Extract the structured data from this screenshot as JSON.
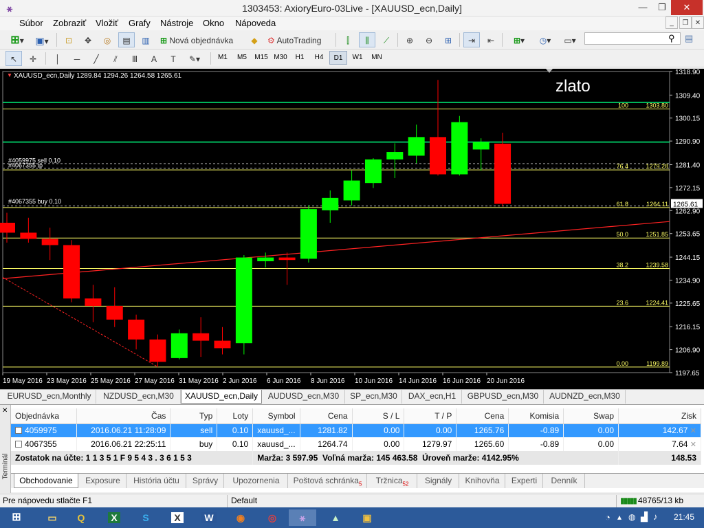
{
  "window": {
    "title": "1303453: AxioryEuro-03Live - [XAUUSD_ecn,Daily]",
    "minimize": "—",
    "restore": "❐",
    "close": "✕"
  },
  "menu": [
    "Súbor",
    "Zobraziť",
    "Vložiť",
    "Grafy",
    "Nástroje",
    "Okno",
    "Nápoveda"
  ],
  "toolbar": {
    "new_order": "Nová objednávka",
    "autotrading": "AutoTrading",
    "timeframes": [
      "M1",
      "M5",
      "M15",
      "M30",
      "H1",
      "H4",
      "D1",
      "W1",
      "MN"
    ],
    "active_timeframe": "D1"
  },
  "chart": {
    "header": "XAUUSD_ecn,Daily  1289.84 1294.26 1264.58 1265.61",
    "symbol_text": "zlato",
    "current_price_label": "1265.61",
    "order_labels": [
      "#4059975 sell 0.10",
      "#4067355 tp",
      "#4067355 buy 0.10"
    ],
    "colors": {
      "bull": "#00ff00",
      "bear": "#ff0000",
      "fib": "#ffff66",
      "order": "#00ff80",
      "trend": "#ff2222",
      "axis": "#ffffff"
    }
  },
  "chart_data": {
    "type": "candlestick",
    "title": "XAUUSD_ecn,Daily",
    "ylim": [
      1197.65,
      1318.9
    ],
    "y_ticks": [
      "1318.90",
      "1309.40",
      "1300.15",
      "1290.90",
      "1281.40",
      "1272.15",
      "1262.90",
      "1253.65",
      "1244.15",
      "1234.90",
      "1225.65",
      "1216.15",
      "1206.90",
      "1197.65"
    ],
    "x_ticks": [
      "19 May 2016",
      "23 May 2016",
      "25 May 2016",
      "27 May 2016",
      "31 May 2016",
      "2 Jun 2016",
      "6 Jun 2016",
      "8 Jun 2016",
      "10 Jun 2016",
      "14 Jun 2016",
      "16 Jun 2016",
      "20 Jun 2016"
    ],
    "candles": [
      {
        "o": 1258.0,
        "h": 1262.0,
        "l": 1250.0,
        "c": 1254.0
      },
      {
        "o": 1254.0,
        "h": 1260.0,
        "l": 1250.0,
        "c": 1251.5
      },
      {
        "o": 1251.5,
        "h": 1256.0,
        "l": 1243.0,
        "c": 1249.0
      },
      {
        "o": 1249.0,
        "h": 1251.0,
        "l": 1226.0,
        "c": 1227.5
      },
      {
        "o": 1227.5,
        "h": 1233.0,
        "l": 1218.0,
        "c": 1224.5
      },
      {
        "o": 1224.5,
        "h": 1232.0,
        "l": 1216.0,
        "c": 1219.0
      },
      {
        "o": 1219.0,
        "h": 1221.0,
        "l": 1207.0,
        "c": 1211.0
      },
      {
        "o": 1211.0,
        "h": 1213.0,
        "l": 1199.9,
        "c": 1202.0
      },
      {
        "o": 1203.5,
        "h": 1215.0,
        "l": 1203.0,
        "c": 1213.5
      },
      {
        "o": 1213.5,
        "h": 1220.0,
        "l": 1204.0,
        "c": 1210.5
      },
      {
        "o": 1210.5,
        "h": 1216.0,
        "l": 1205.0,
        "c": 1207.5
      },
      {
        "o": 1209.5,
        "h": 1245.0,
        "l": 1205.0,
        "c": 1244.0
      },
      {
        "o": 1242.5,
        "h": 1246.0,
        "l": 1240.0,
        "c": 1244.0
      },
      {
        "o": 1244.0,
        "h": 1246.0,
        "l": 1233.0,
        "c": 1243.0
      },
      {
        "o": 1243.5,
        "h": 1265.0,
        "l": 1242.0,
        "c": 1263.5
      },
      {
        "o": 1263.0,
        "h": 1271.0,
        "l": 1258.0,
        "c": 1268.0
      },
      {
        "o": 1267.0,
        "h": 1279.0,
        "l": 1265.0,
        "c": 1275.0
      },
      {
        "o": 1274.0,
        "h": 1284.0,
        "l": 1272.0,
        "c": 1283.5
      },
      {
        "o": 1283.5,
        "h": 1290.0,
        "l": 1276.0,
        "c": 1286.5
      },
      {
        "o": 1285.0,
        "h": 1297.5,
        "l": 1282.0,
        "c": 1292.5
      },
      {
        "o": 1292.5,
        "h": 1315.5,
        "l": 1277.0,
        "c": 1277.5
      },
      {
        "o": 1277.5,
        "h": 1301.0,
        "l": 1277.0,
        "c": 1298.5
      },
      {
        "o": 1287.5,
        "h": 1292.0,
        "l": 1279.0,
        "c": 1290.5
      },
      {
        "o": 1289.84,
        "h": 1294.26,
        "l": 1264.58,
        "c": 1265.61
      }
    ],
    "fibonacci": [
      {
        "level": "100",
        "price": "1303.80"
      },
      {
        "level": "76.4",
        "price": "1279.28"
      },
      {
        "level": "61.8",
        "price": "1264.11"
      },
      {
        "level": "50.0",
        "price": "1251.85"
      },
      {
        "level": "38.2",
        "price": "1239.58"
      },
      {
        "level": "23.6",
        "price": "1224.41"
      },
      {
        "level": "0.00",
        "price": "1199.89"
      }
    ],
    "order_levels": [
      1306.5,
      1290.5,
      1281.82,
      1279.97,
      1264.74
    ]
  },
  "chart_tabs": [
    "EURUSD_ecn,Monthly",
    "NZDUSD_ecn,M30",
    "XAUUSD_ecn,Daily",
    "AUDUSD_ecn,M30",
    "SP_ecn,M30",
    "DAX_ecn,H1",
    "GBPUSD_ecn,M30",
    "AUDNZD_ecn,M30"
  ],
  "active_chart_tab": "XAUUSD_ecn,Daily",
  "terminal": {
    "side_label": "Terminál",
    "columns": [
      "Objednávka",
      "Čas",
      "Typ",
      "Loty",
      "Symbol",
      "Cena",
      "S / L",
      "T / P",
      "Cena",
      "Komisia",
      "Swap",
      "Zisk"
    ],
    "rows": [
      [
        "4059975",
        "2016.06.21 11:28:09",
        "sell",
        "0.10",
        "xauusd_...",
        "1281.82",
        "0.00",
        "0.00",
        "1265.76",
        "-0.89",
        "0.00",
        "142.67"
      ],
      [
        "4067355",
        "2016.06.21 22:25:11",
        "buy",
        "0.10",
        "xauusd_...",
        "1264.74",
        "0.00",
        "1279.97",
        "1265.60",
        "-0.89",
        "0.00",
        "7.64"
      ]
    ],
    "summary": {
      "balance": "Zostatok na účte: 1  1 3 5 1  F  9 5 4 3 . 3 6 1 5 3",
      "margin": "Marža: 3 597.95",
      "free_margin": "Voľná marža: 145 463.58",
      "margin_level": "Úroveň marže: 4142.95%",
      "total": "148.53"
    },
    "tabs": [
      "Obchodovanie",
      "Exposure",
      "História účtu",
      "Správy",
      "Upozornenia",
      "Poštová schránka",
      "Tržnica",
      "Signály",
      "Knihovňa",
      "Experti",
      "Denník"
    ],
    "tab_badges": {
      "mailbox": "5",
      "market": "52"
    }
  },
  "status": {
    "help": "Pre nápovedu stlačte F1",
    "profile": "Default",
    "traffic": "48765/13 kb"
  },
  "taskbar": {
    "clock": "21:45"
  }
}
